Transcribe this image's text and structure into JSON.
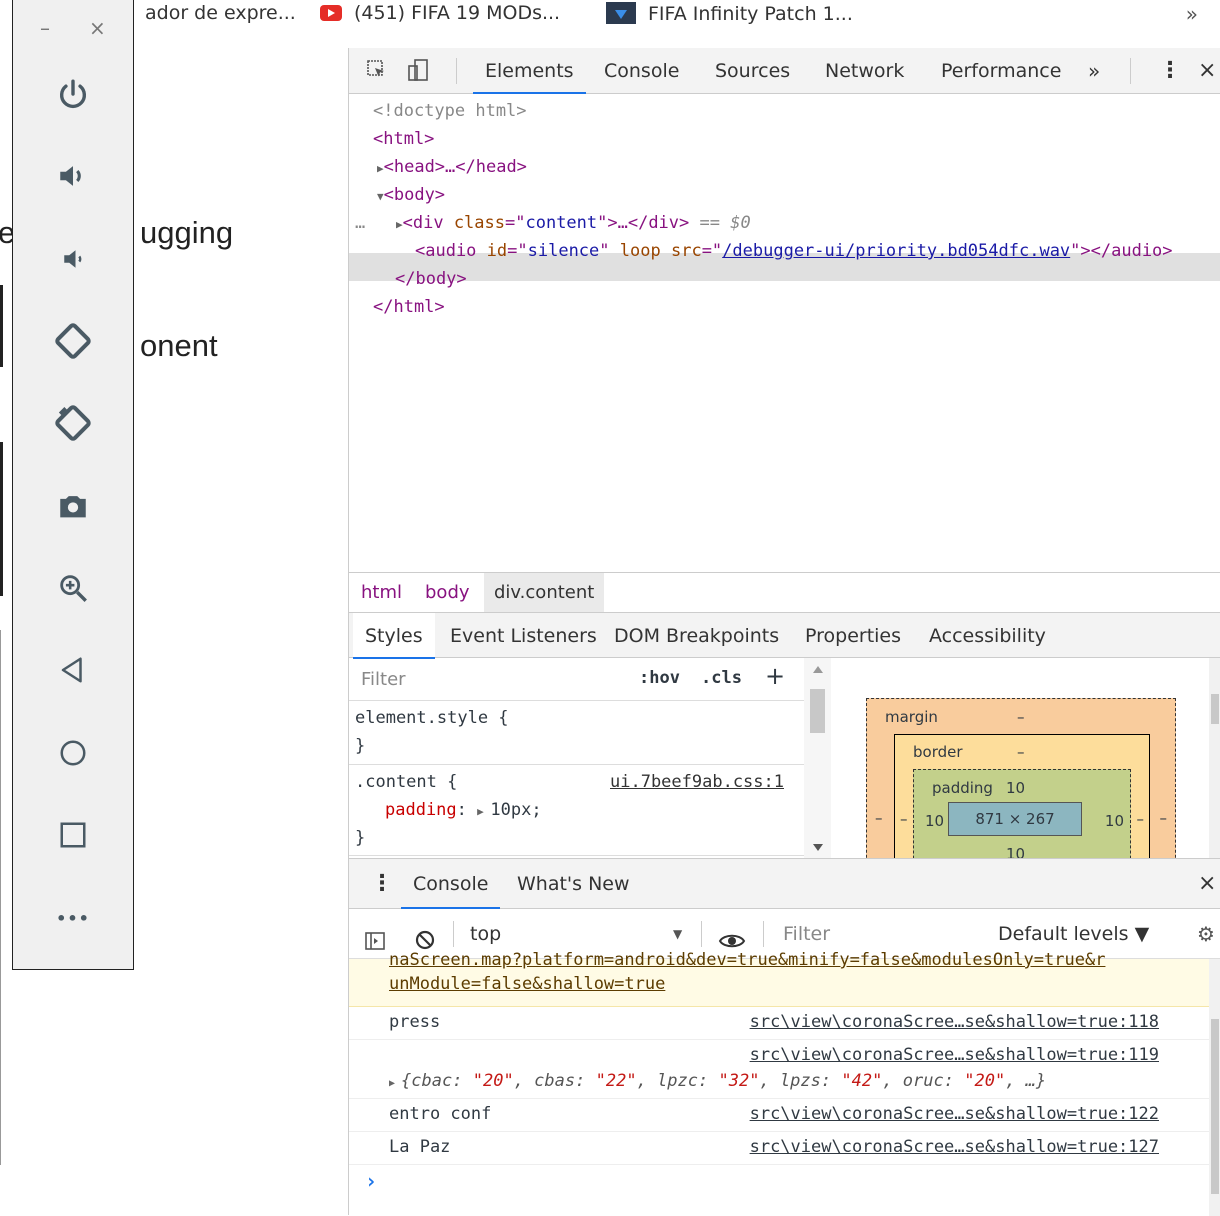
{
  "bookmarks": {
    "item1": "ador de expre...",
    "item2": "(451) FIFA 19 MODs...",
    "item3": "FIFA Infinity Patch 1...",
    "overflow": "»"
  },
  "page": {
    "line1_left": "e",
    "line1_right": "ugging",
    "line2_right": "onent"
  },
  "emulator": {
    "minimize": "–",
    "close": "×",
    "more": "•••",
    "tools": [
      "power-icon",
      "volume-up-icon",
      "volume-down-icon",
      "rotate-left-icon",
      "rotate-right-icon",
      "camera-icon",
      "zoom-in-icon",
      "back-icon",
      "home-icon",
      "overview-icon",
      "more-icon"
    ]
  },
  "devtools": {
    "tabs": [
      "Elements",
      "Console",
      "Sources",
      "Network",
      "Performance"
    ],
    "tabs_overflow": "»",
    "kebab": "⋮",
    "close": "×",
    "tree": {
      "doctype": "<!doctype html>",
      "html_open": "<html>",
      "head": "<head>…</head>",
      "body_open": "<body>",
      "div_tag_open": "<div ",
      "div_attr": "class",
      "div_eq": "=\"",
      "div_val": "content",
      "div_close": "\">…</div>",
      "div_sel": " == $0",
      "row_dots": "…",
      "audio_open": "<audio ",
      "audio_attr1": "id",
      "audio_val1": "silence",
      "audio_attr2": "loop",
      "audio_attr3": "src",
      "audio_link": "/debugger-ui/priority.bd054dfc.wav",
      "audio_close": "\"></audio>",
      "body_close": "</body>",
      "html_close": "</html>"
    },
    "breadcrumbs": [
      "html",
      "body",
      "div.content"
    ],
    "subtabs": [
      "Styles",
      "Event Listeners",
      "DOM Breakpoints",
      "Properties",
      "Accessibility"
    ],
    "styles": {
      "filter_placeholder": "Filter",
      "hov": ":hov",
      "cls": ".cls",
      "plus": "+",
      "element_style": "element.style {",
      "brace_close": "}",
      "content_selector": ".content {",
      "content_source": "ui.7beef9ab.css:1",
      "prop_name": "padding",
      "prop_value": "10px;"
    },
    "boxmodel": {
      "margin_label": "margin",
      "margin_value": "–",
      "border_label": "border",
      "border_value": "–",
      "padding_label": "padding",
      "padding_top": "10",
      "padding_left": "10",
      "padding_right": "10",
      "padding_bottom": "10",
      "content_size": "871 × 267",
      "side_dash": "–"
    },
    "console": {
      "drawer_tabs": [
        "Console",
        "What's New"
      ],
      "context": "top",
      "filter_placeholder": "Filter",
      "levels": "Default levels ▼",
      "messages": {
        "warn_line1": "naScreen.map?platform=android&dev=true&minify=false&modulesOnly=true&r",
        "warn_line2": "unModule=false&shallow=true",
        "m1_text": "press",
        "m1_src": "src\\view\\coronaScree…se&shallow=true:118",
        "m2_src": "src\\view\\coronaScree…se&shallow=true:119",
        "m2_obj": {
          "k1": "cbac",
          "v1": "\"20\"",
          "k2": "cbas",
          "v2": "\"22\"",
          "k3": "lpzc",
          "v3": "\"32\"",
          "k4": "lpzs",
          "v4": "\"42\"",
          "k5": "oruc",
          "v5": "\"20\"",
          "tail": ", …}"
        },
        "m3_text": "entro conf",
        "m3_src": "src\\view\\coronaScree…se&shallow=true:122",
        "m4_text": "La Paz",
        "m4_src": "src\\view\\coronaScree…se&shallow=true:127",
        "prompt": "›"
      }
    }
  }
}
